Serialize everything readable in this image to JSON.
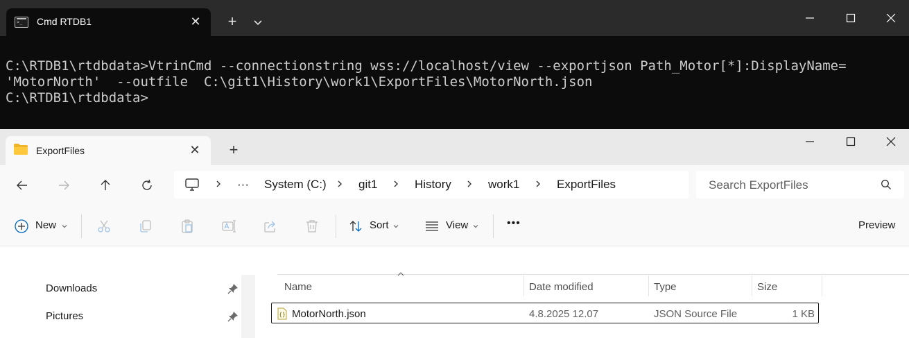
{
  "terminal": {
    "tab_title": "Cmd RTDB1",
    "close_symbol": "✕",
    "newtab_symbol": "+",
    "lines": [
      "C:\\RTDB1\\rtdbdata>VtrinCmd --connectionstring wss://localhost/view --exportjson Path_Motor[*]:DisplayName=",
      "'MotorNorth'  --outfile  C:\\git1\\History\\work1\\ExportFiles\\MotorNorth.json",
      "",
      "C:\\RTDB1\\rtdbdata>"
    ]
  },
  "explorer": {
    "tab_title": "ExportFiles",
    "close_symbol": "✕",
    "newtab_symbol": "+",
    "address": {
      "more": "···",
      "crumbs": [
        "System (C:)",
        "git1",
        "History",
        "work1",
        "ExportFiles"
      ]
    },
    "search_placeholder": "Search ExportFiles",
    "toolbar": {
      "new_label": "New",
      "sort_label": "Sort",
      "view_label": "View",
      "more": "•••",
      "preview_label": "Preview"
    },
    "quick_access": [
      {
        "label": "Downloads"
      },
      {
        "label": "Pictures"
      }
    ],
    "columns": {
      "name": "Name",
      "date": "Date modified",
      "type": "Type",
      "size": "Size"
    },
    "files": [
      {
        "name": "MotorNorth.json",
        "date": "4.8.2025 12.07",
        "type": "JSON Source File",
        "size": "1 KB"
      }
    ]
  },
  "colors": {
    "terminal_bg": "#0c0c0c",
    "terminal_text": "#cccccc",
    "accent": "#0067c0",
    "folder": "#f0b429"
  },
  "icons": [
    "terminal-icon",
    "folder-icon",
    "back-arrow-icon",
    "forward-arrow-icon",
    "up-arrow-icon",
    "refresh-icon",
    "this-pc-icon",
    "search-icon",
    "plus-circle-icon",
    "cut-icon",
    "copy-icon",
    "paste-icon",
    "rename-icon",
    "share-icon",
    "delete-icon",
    "sort-icon",
    "view-icon",
    "pin-icon",
    "json-file-icon"
  ]
}
